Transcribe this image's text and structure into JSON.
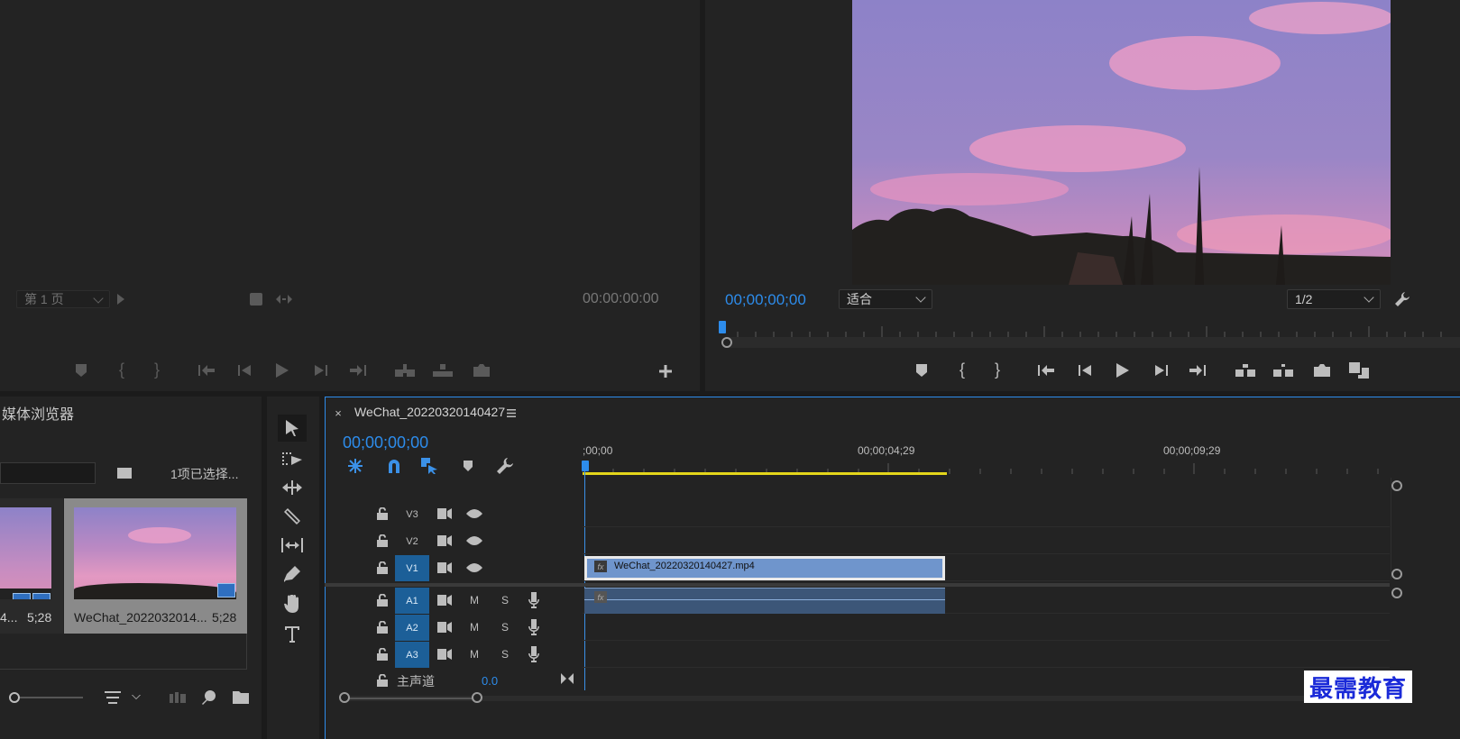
{
  "source_monitor": {
    "page_label": "第 1 页",
    "timecode": "00:00:00:00"
  },
  "program_monitor": {
    "timecode": "00;00;00;00",
    "fit_label": "适合",
    "resolution_label": "1/2",
    "accent_color": "#2d8ceb"
  },
  "media_browser": {
    "tab_label": "媒体浏览器",
    "selection_status": "1项已选择...",
    "items": [
      {
        "name": "4...",
        "duration": "5;28"
      },
      {
        "name": "WeChat_2022032014...",
        "duration": "5;28"
      }
    ]
  },
  "timeline": {
    "sequence_name": "WeChat_20220320140427",
    "timecode": "00;00;00;00",
    "ruler_labels": [
      ";00;00",
      "00;00;04;29",
      "00;00;09;29"
    ],
    "video_tracks": [
      {
        "name": "V3",
        "active": false
      },
      {
        "name": "V2",
        "active": false
      },
      {
        "name": "V1",
        "active": true
      }
    ],
    "audio_tracks": [
      {
        "name": "A1",
        "mute": "M",
        "solo": "S"
      },
      {
        "name": "A2",
        "mute": "M",
        "solo": "S"
      },
      {
        "name": "A3",
        "mute": "M",
        "solo": "S"
      }
    ],
    "master": {
      "label": "主声道",
      "value": "0.0"
    },
    "video_clip": {
      "name": "WeChat_20220320140427.mp4",
      "fx": "fx",
      "color": "#6f95cc"
    },
    "audio_clip": {
      "fx": "fx",
      "color": "#3c5678"
    },
    "work_area_color": "#e3d51b"
  },
  "watermark": "最需教育"
}
